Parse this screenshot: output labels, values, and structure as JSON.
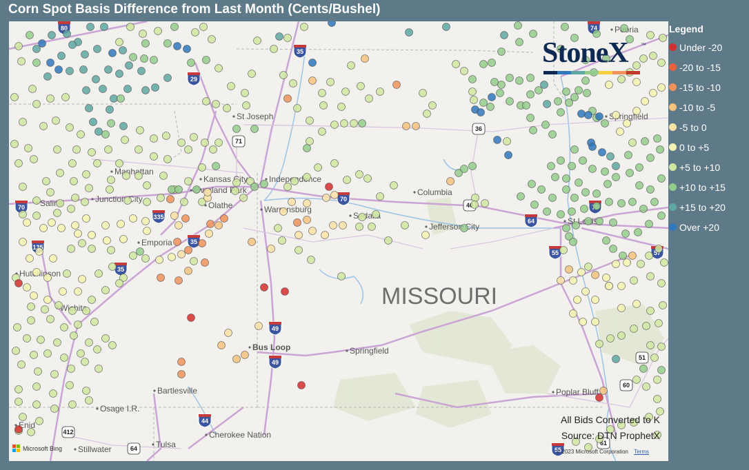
{
  "title": "Corn Spot Basis Difference from Last Month (Cents/Bushel)",
  "legend": {
    "title": "Legend",
    "items": [
      {
        "label": "Under -20",
        "color": "#d32f2f"
      },
      {
        "label": "-20 to -15",
        "color": "#e8603c"
      },
      {
        "label": "-15 to -10",
        "color": "#f0925a"
      },
      {
        "label": "-10 to -5",
        "color": "#f6c27c"
      },
      {
        "label": "-5 to 0",
        "color": "#fbe2a6"
      },
      {
        "label": "0 to +5",
        "color": "#f4f4b2"
      },
      {
        "label": "+5 to +10",
        "color": "#cfe7a0"
      },
      {
        "label": "+10 to +15",
        "color": "#94cc8c"
      },
      {
        "label": "+15 to +20",
        "color": "#5fa7a2"
      },
      {
        "label": "Over +20",
        "color": "#2f78bd"
      }
    ]
  },
  "logo": {
    "text": "StoneX",
    "tm": "™",
    "bar_colors": [
      "#0f2a52",
      "#2f78bd",
      "#5fa7a2",
      "#94cc8c",
      "#f4d03f",
      "#f0925a",
      "#c0392b"
    ]
  },
  "map": {
    "state_label": "MISSOURI",
    "cities": [
      {
        "name": "Peoria"
      },
      {
        "name": "St Joseph"
      },
      {
        "name": "Kansas City"
      },
      {
        "name": "Independence"
      },
      {
        "name": "Manhattan"
      },
      {
        "name": "Overland Park"
      },
      {
        "name": "Olathe"
      },
      {
        "name": "Warrensburg"
      },
      {
        "name": "Salina"
      },
      {
        "name": "Junction City"
      },
      {
        "name": "Sedalia"
      },
      {
        "name": "Columbia"
      },
      {
        "name": "Jefferson City"
      },
      {
        "name": "St Louis"
      },
      {
        "name": "Springfield"
      },
      {
        "name": "Emporia"
      },
      {
        "name": "Hutchinson"
      },
      {
        "name": "Wichita"
      },
      {
        "name": "Bus Loop"
      },
      {
        "name": "Springfield"
      },
      {
        "name": "Bartlesville"
      },
      {
        "name": "Osage I.R."
      },
      {
        "name": "Cherokee Nation"
      },
      {
        "name": "Poplar Bluff"
      },
      {
        "name": "Enid"
      },
      {
        "name": "Stillwater"
      },
      {
        "name": "Tulsa"
      }
    ],
    "interstates": [
      "80",
      "35",
      "29",
      "70",
      "70",
      "70",
      "335",
      "35",
      "35",
      "135",
      "49",
      "49",
      "44",
      "64",
      "55",
      "57",
      "55",
      "74"
    ],
    "us_routes": [
      "71",
      "36",
      "40",
      "51",
      "60",
      "412",
      "64",
      "61"
    ],
    "note_line1": "All Bids Converted to K",
    "note_line2": "Source: DTN ProphetX",
    "attribution": "Microsoft Bing",
    "copyright": "© 2023 Microsoft Corporation",
    "terms": "Terms"
  }
}
